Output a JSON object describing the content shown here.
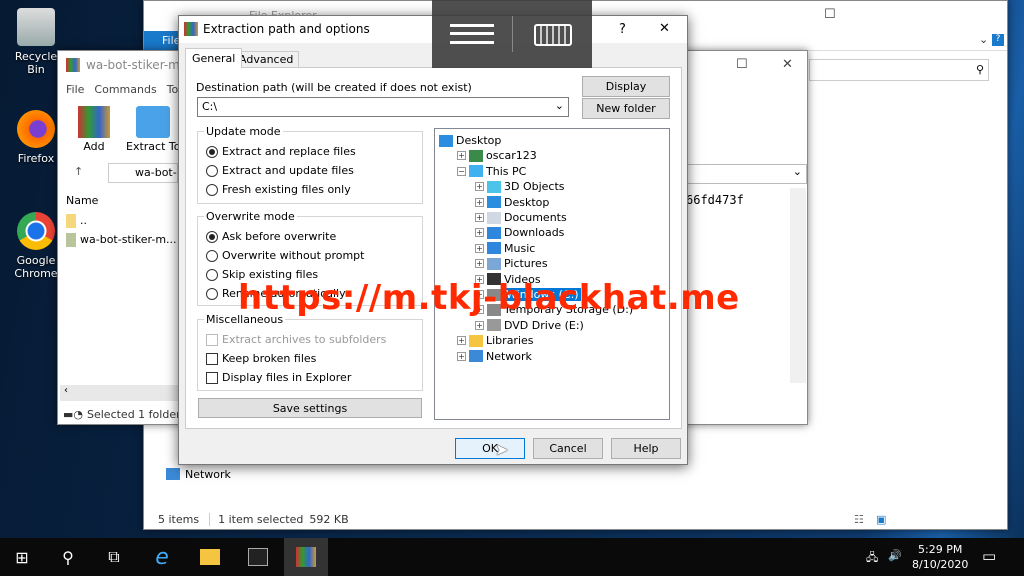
{
  "desktop": {
    "icons": [
      {
        "label": "Recycle Bin",
        "icon": "recycle-bin-icon"
      },
      {
        "label": "Firefox",
        "icon": "firefox-icon"
      },
      {
        "label": "Google Chrome",
        "icon": "chrome-icon"
      }
    ]
  },
  "explorer": {
    "title": "File Explorer",
    "ribbon_tab": "File",
    "nav_network": "Network",
    "status_items": "5 items",
    "status_selected": "1 item selected",
    "status_size": "592 KB"
  },
  "winrar": {
    "title": "wa-bot-stiker-master",
    "menu": [
      "File",
      "Commands",
      "To"
    ],
    "toolbar": [
      "Add",
      "Extract To"
    ],
    "address": "wa-bot-stiker-master",
    "column_name": "Name",
    "rows": [
      "..",
      "wa-bot-stiker-m..."
    ],
    "hash_text": "66fd473f",
    "status": "Selected 1 folder"
  },
  "dialog": {
    "title": "Extraction path and options",
    "help": "?",
    "close": "✕",
    "tabs": [
      {
        "label": "General",
        "active": true
      },
      {
        "label": "Advanced",
        "active": false
      }
    ],
    "dest_label": "Destination path (will be created if does not exist)",
    "dest_value": "C:\\",
    "display_button": "Display",
    "new_folder_button": "New folder",
    "update_mode": {
      "title": "Update mode",
      "options": [
        {
          "label": "Extract and replace files",
          "selected": true
        },
        {
          "label": "Extract and update files",
          "selected": false
        },
        {
          "label": "Fresh existing files only",
          "selected": false
        }
      ]
    },
    "overwrite_mode": {
      "title": "Overwrite mode",
      "options": [
        {
          "label": "Ask before overwrite",
          "selected": true
        },
        {
          "label": "Overwrite without prompt",
          "selected": false
        },
        {
          "label": "Skip existing files",
          "selected": false
        },
        {
          "label": "Rename automatically",
          "selected": false
        }
      ]
    },
    "misc": {
      "title": "Miscellaneous",
      "options": [
        {
          "label": "Extract archives to subfolders",
          "checked": false,
          "disabled": true
        },
        {
          "label": "Keep broken files",
          "checked": false,
          "disabled": false
        },
        {
          "label": "Display files in Explorer",
          "checked": false,
          "disabled": false
        }
      ]
    },
    "save_settings": "Save settings",
    "tree": [
      {
        "label": "Desktop",
        "level": 0,
        "exp": "",
        "icon": "desktop-icon"
      },
      {
        "label": "oscar123",
        "level": 1,
        "exp": "+",
        "icon": "user-icon"
      },
      {
        "label": "This PC",
        "level": 1,
        "exp": "−",
        "icon": "computer-icon"
      },
      {
        "label": "3D Objects",
        "level": 2,
        "exp": "+",
        "icon": "cube-icon"
      },
      {
        "label": "Desktop",
        "level": 2,
        "exp": "+",
        "icon": "desktop-icon"
      },
      {
        "label": "Documents",
        "level": 2,
        "exp": "+",
        "icon": "document-icon"
      },
      {
        "label": "Downloads",
        "level": 2,
        "exp": "+",
        "icon": "download-icon"
      },
      {
        "label": "Music",
        "level": 2,
        "exp": "+",
        "icon": "music-icon"
      },
      {
        "label": "Pictures",
        "level": 2,
        "exp": "+",
        "icon": "pictures-icon"
      },
      {
        "label": "Videos",
        "level": 2,
        "exp": "+",
        "icon": "video-icon"
      },
      {
        "label": "Windows (C:)",
        "level": 2,
        "exp": "+",
        "icon": "drive-icon",
        "selected": true
      },
      {
        "label": "Temporary Storage (D:)",
        "level": 2,
        "exp": "+",
        "icon": "drive-icon"
      },
      {
        "label": "DVD Drive (E:)",
        "level": 2,
        "exp": "+",
        "icon": "dvd-icon"
      },
      {
        "label": "Libraries",
        "level": 1,
        "exp": "+",
        "icon": "library-icon"
      },
      {
        "label": "Network",
        "level": 1,
        "exp": "+",
        "icon": "network-icon"
      }
    ],
    "ok": "OK",
    "cancel": "Cancel",
    "help_button": "Help"
  },
  "overlay": {
    "menu_icon": "hamburger-icon",
    "keyboard_icon": "keyboard-icon"
  },
  "watermark": "https://m.tkj-blackhat.me",
  "taskbar": {
    "time": "5:29 PM",
    "date": "8/10/2020"
  },
  "colors": {
    "accent": "#0078d7",
    "watermark": "#ff2a00",
    "selection": "#0078d7"
  }
}
